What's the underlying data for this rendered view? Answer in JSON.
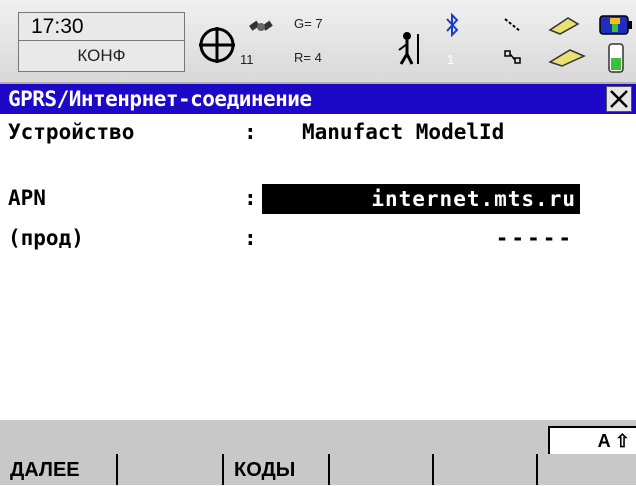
{
  "status": {
    "time": "17:30",
    "mode": "КОНФ",
    "positioning": {
      "sats": "11",
      "g": "G= 7",
      "r": "R= 4"
    },
    "line_number": "1"
  },
  "title": {
    "text": "GPRS/Интенрнет-соединение",
    "close_icon": "close-icon"
  },
  "fields": {
    "device": {
      "label": "Устройство",
      "colon": ":",
      "value": "Manufact ModelId"
    },
    "apn": {
      "label": "APN",
      "colon": ":",
      "value": "internet.mts.ru"
    },
    "prod": {
      "label": "(прод)",
      "colon": ":",
      "value": "-----"
    }
  },
  "input_mode": "A ⇧",
  "softkeys": [
    "ДАЛЕЕ",
    "",
    "КОДЫ",
    "",
    "",
    ""
  ],
  "colors": {
    "title_bar": "#1d08c8",
    "softkey_bg": "#c8c8c8",
    "highlight": "#000000"
  }
}
